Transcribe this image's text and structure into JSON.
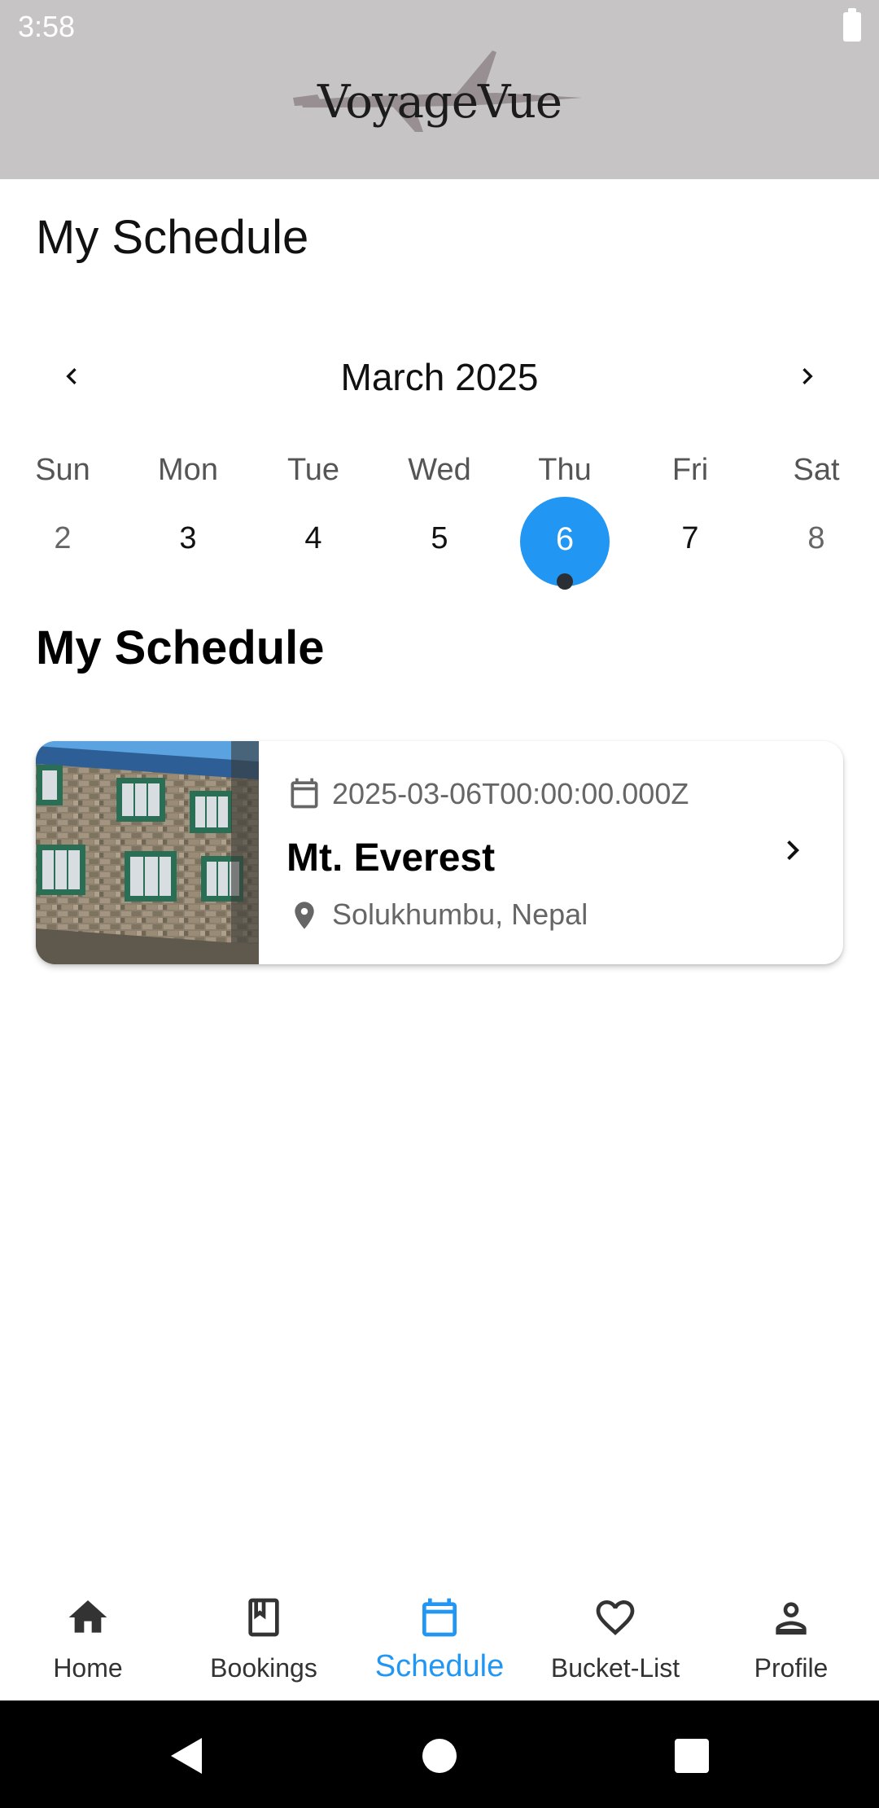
{
  "status_bar": {
    "time": "3:58"
  },
  "header": {
    "logo_text": "VoyageVue"
  },
  "page": {
    "title": "My Schedule"
  },
  "calendar": {
    "month_label": "March 2025",
    "weekdays": [
      "Sun",
      "Mon",
      "Tue",
      "Wed",
      "Thu",
      "Fri",
      "Sat"
    ],
    "days": [
      "2",
      "3",
      "4",
      "5",
      "6",
      "7",
      "8"
    ],
    "selected_index": 4,
    "selected_day": "6",
    "accent_color": "#2196f3",
    "event_dot_color": "#2a2f36"
  },
  "section": {
    "title": "My Schedule"
  },
  "schedule_items": [
    {
      "date": "2025-03-06T00:00:00.000Z",
      "title": "Mt. Everest",
      "location": "Solukhumbu, Nepal",
      "image_icon": "lodge-photo",
      "date_icon": "calendar-icon",
      "location_icon": "location-pin-icon",
      "action_icon": "chevron-right-icon"
    }
  ],
  "bottom_nav": {
    "active": "Schedule",
    "items": [
      {
        "label": "Home",
        "icon": "home-icon"
      },
      {
        "label": "Bookings",
        "icon": "bookmark-icon"
      },
      {
        "label": "Schedule",
        "icon": "calendar-icon"
      },
      {
        "label": "Bucket-List",
        "icon": "heart-icon"
      },
      {
        "label": "Profile",
        "icon": "person-icon"
      }
    ]
  },
  "system_nav": {
    "icons": [
      "back-icon",
      "home-circle-icon",
      "recents-icon"
    ]
  }
}
